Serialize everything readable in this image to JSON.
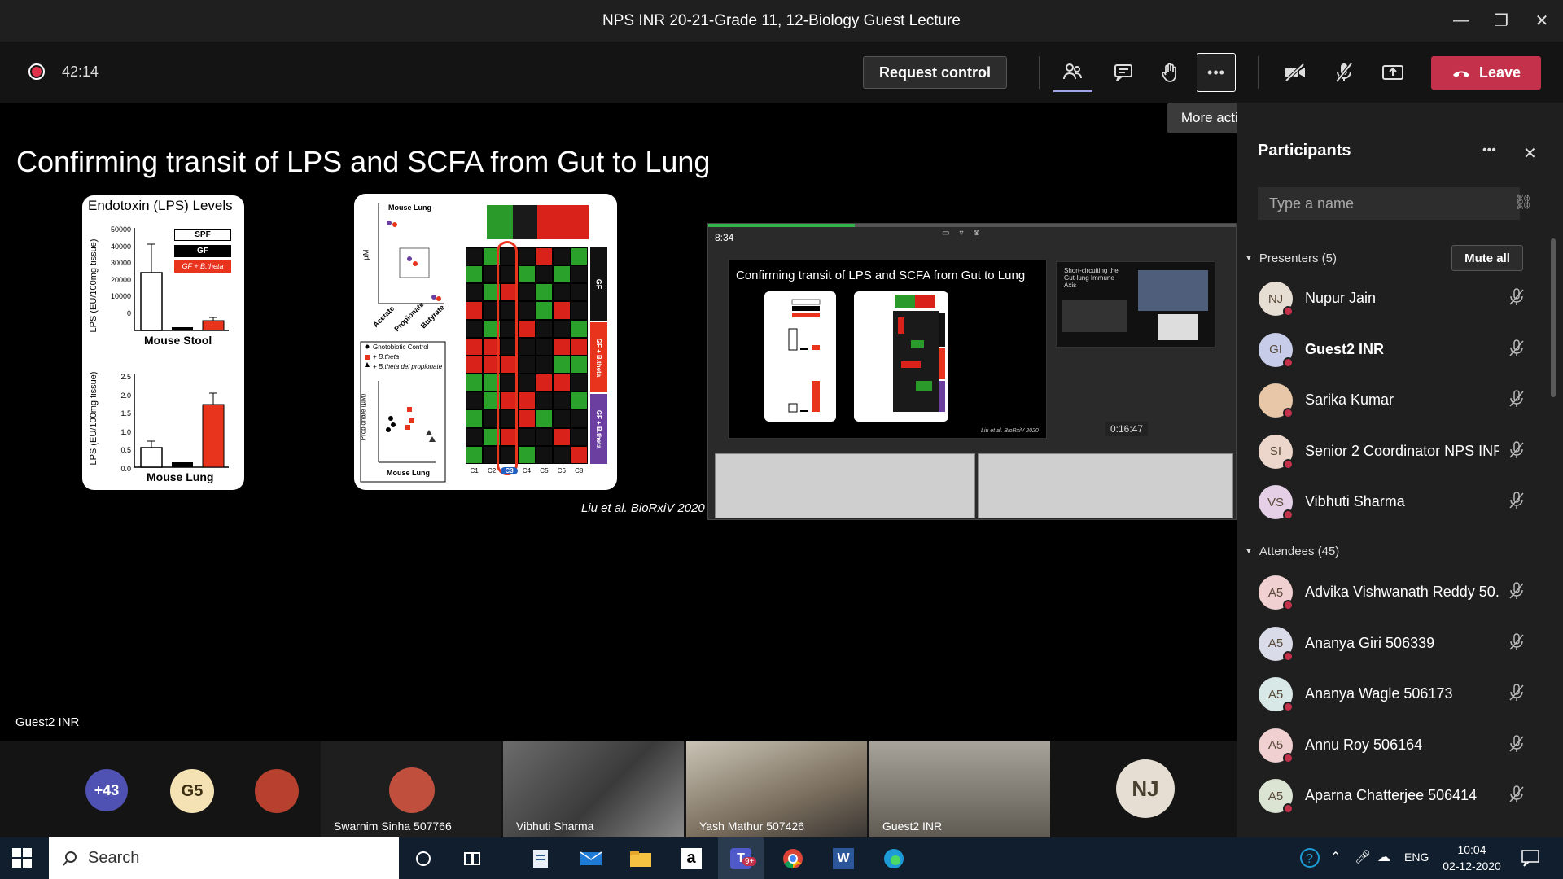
{
  "window": {
    "title": "NPS INR 20-21-Grade 11, 12-Biology Guest Lecture",
    "minimize": "—",
    "maximize": "❐",
    "close": "✕"
  },
  "toolbar": {
    "timer": "42:14",
    "request_control": "Request control",
    "leave": "Leave",
    "more_actions_tooltip": "More actions",
    "more_glyph": "•••"
  },
  "stage": {
    "slide_title": "Confirming transit of LPS and SCFA from Gut to Lung",
    "citation": "Liu et al. BioRxiV 2020",
    "label": "Guest2 INR",
    "fig1": {
      "title": "Endotoxin (LPS) Levels",
      "legend": [
        "SPF",
        "GF",
        "GF + B.theta"
      ],
      "top_ylabel": "LPS (EU/100mg tissue)",
      "top_ticks": [
        "50000",
        "40000",
        "30000",
        "20000",
        "10000",
        "0"
      ],
      "top_xlabel": "Mouse Stool",
      "bottom_ylabel": "LPS (EU/100mg tissue)",
      "bottom_ticks": [
        "2.5",
        "2.0",
        "1.5",
        "1.0",
        "0.5",
        "0.0"
      ],
      "bottom_xlabel": "Mouse Lung"
    },
    "fig2": {
      "top_label": "Mouse Lung",
      "y_unit": "µM",
      "x_ticks": [
        "Acetate",
        "Propionate",
        "Butyrate"
      ],
      "legend": [
        "Gnotobiotic Control",
        "+ B.theta",
        "+ B.theta del propionate"
      ],
      "prop_ylabel": "Propionate (µM)",
      "bottom_label": "Mouse Lung",
      "side_labels": [
        "GF",
        "GF + B.theta",
        "GF + B.theta"
      ],
      "cols": [
        "C1",
        "C2",
        "C3",
        "C4",
        "C5",
        "C6",
        "C8"
      ]
    },
    "screen": {
      "time": "8:34",
      "inner_title": "Confirming transit of LPS and SCFA from Gut to Lung",
      "side_title": "Short-circuiting the Gut-lung Immune Axis",
      "elapsed": "0:16:47",
      "inner_citation": "Liu et al. BioRxiV 2020"
    }
  },
  "strip": {
    "overflow": "+43",
    "g5": "G5",
    "tiles": [
      {
        "name": "Swarnim Sinha 507766"
      },
      {
        "name": "Vibhuti Sharma"
      },
      {
        "name": "Yash Mathur 507426"
      },
      {
        "name": "Guest2 INR"
      }
    ],
    "nj": "NJ"
  },
  "panel": {
    "title": "Participants",
    "search_placeholder": "Type a name",
    "presenters_header": "Presenters (5)",
    "mute_all": "Mute all",
    "attendees_header": "Attendees (45)",
    "presenters": [
      {
        "initials": "NJ",
        "name": "Nupur Jain",
        "color": "#e6ded3"
      },
      {
        "initials": "GI",
        "name": "Guest2 INR",
        "color": "#c7cde9"
      },
      {
        "initials": "",
        "name": "Sarika Kumar",
        "color": "#e8c7a8"
      },
      {
        "initials": "SI",
        "name": "Senior 2 Coordinator NPS INR",
        "color": "#ecd6cb"
      },
      {
        "initials": "VS",
        "name": "Vibhuti Sharma",
        "color": "#e4cfe6"
      }
    ],
    "attendees": [
      {
        "initials": "A5",
        "name": "Advika Vishwanath Reddy 50...",
        "color": "#f0d0d0"
      },
      {
        "initials": "A5",
        "name": "Ananya Giri 506339",
        "color": "#d9dbe8"
      },
      {
        "initials": "A5",
        "name": "Ananya Wagle 506173",
        "color": "#d7e8e6"
      },
      {
        "initials": "A5",
        "name": "Annu Roy 506164",
        "color": "#f0d0d0"
      },
      {
        "initials": "A5",
        "name": "Aparna Chatterjee 506414",
        "color": "#dbe4d2"
      }
    ]
  },
  "taskbar": {
    "search": "Search",
    "lang": "ENG",
    "time": "10:04",
    "date": "02-12-2020",
    "teams_badge": "9+"
  }
}
